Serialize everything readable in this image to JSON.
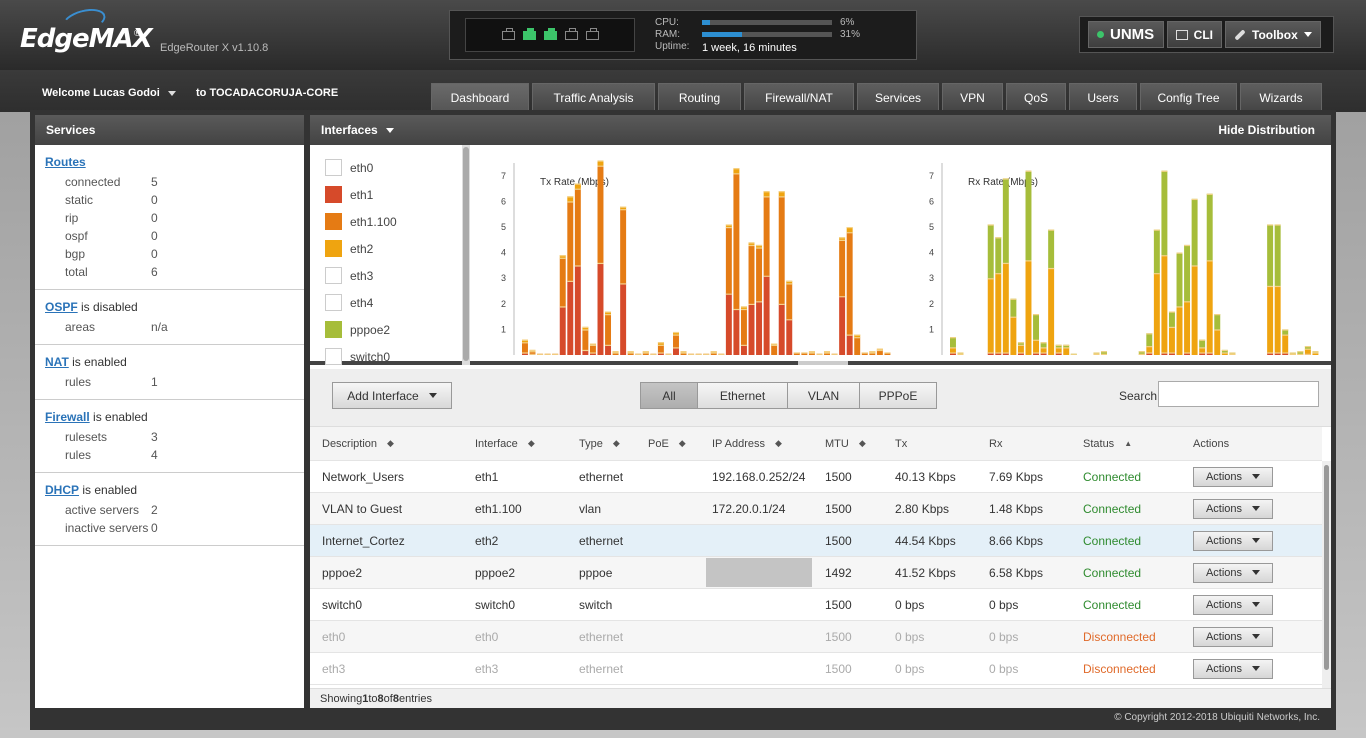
{
  "header": {
    "logo": "EdgeMAX",
    "logo_reg": "®",
    "version": "EdgeRouter X v1.10.8",
    "cpu_label": "CPU:",
    "cpu_value": "6%",
    "cpu_fraction": 0.06,
    "ram_label": "RAM:",
    "ram_value": "31%",
    "ram_fraction": 0.31,
    "uptime_label": "Uptime:",
    "uptime_value": "1 week, 16 minutes",
    "ports_active": [
      false,
      true,
      true,
      false,
      false
    ]
  },
  "toolbar": {
    "unms": "UNMS",
    "cli": "CLI",
    "toolbox": "Toolbox"
  },
  "user": {
    "welcome": "Welcome Lucas Godoi",
    "router": "to TOCADACORUJA-CORE"
  },
  "tabs": [
    "Dashboard",
    "Traffic Analysis",
    "Routing",
    "Firewall/NAT",
    "Services",
    "VPN",
    "QoS",
    "Users",
    "Config Tree",
    "Wizards"
  ],
  "services": {
    "title": "Services",
    "routes": {
      "link": "Routes",
      "rows": [
        {
          "k": "connected",
          "v": "5"
        },
        {
          "k": "static",
          "v": "0"
        },
        {
          "k": "rip",
          "v": "0"
        },
        {
          "k": "ospf",
          "v": "0"
        },
        {
          "k": "bgp",
          "v": "0"
        },
        {
          "k": "total",
          "v": "6"
        }
      ]
    },
    "ospf": {
      "link": "OSPF",
      "status": " is disabled",
      "rows": [
        {
          "k": "areas",
          "v": "n/a"
        }
      ]
    },
    "nat": {
      "link": "NAT",
      "status": " is enabled",
      "rows": [
        {
          "k": "rules",
          "v": "1"
        }
      ]
    },
    "firewall": {
      "link": "Firewall",
      "status": " is enabled",
      "rows": [
        {
          "k": "rulesets",
          "v": "3"
        },
        {
          "k": "rules",
          "v": "4"
        }
      ]
    },
    "dhcp": {
      "link": "DHCP",
      "status": " is enabled",
      "rows": [
        {
          "k": "active servers",
          "v": "2"
        },
        {
          "k": "inactive servers",
          "v": "0"
        }
      ]
    }
  },
  "interfaces": {
    "title": "Interfaces",
    "hide_distribution": "Hide Distribution",
    "legend": [
      {
        "name": "eth0",
        "color": "#ffffff"
      },
      {
        "name": "eth1",
        "color": "#d64a2a"
      },
      {
        "name": "eth1.100",
        "color": "#e57b14"
      },
      {
        "name": "eth2",
        "color": "#efa410"
      },
      {
        "name": "eth3",
        "color": "#ffffff"
      },
      {
        "name": "eth4",
        "color": "#ffffff"
      },
      {
        "name": "pppoe2",
        "color": "#a6bd3a"
      },
      {
        "name": "switch0",
        "color": "#ffffff"
      }
    ],
    "add_interface": "Add Interface",
    "filters": [
      "All",
      "Ethernet",
      "VLAN",
      "PPPoE"
    ],
    "search_label": "Search",
    "columns": [
      "Description",
      "Interface",
      "Type",
      "PoE",
      "IP Address",
      "MTU",
      "Tx",
      "Rx",
      "Status",
      "Actions"
    ],
    "rows": [
      {
        "desc": "Network_Users",
        "iface": "eth1",
        "type": "ethernet",
        "poe": "",
        "ip": "192.168.0.252/24",
        "mtu": "1500",
        "tx": "40.13 Kbps",
        "rx": "7.69 Kbps",
        "status": "Connected",
        "action": "Actions"
      },
      {
        "desc": "VLAN to Guest",
        "iface": "eth1.100",
        "type": "vlan",
        "poe": "",
        "ip": "172.20.0.1/24",
        "mtu": "1500",
        "tx": "2.80 Kbps",
        "rx": "1.48 Kbps",
        "status": "Connected",
        "action": "Actions"
      },
      {
        "desc": "Internet_Cortez",
        "iface": "eth2",
        "type": "ethernet",
        "poe": "",
        "ip": "",
        "mtu": "1500",
        "tx": "44.54 Kbps",
        "rx": "8.66 Kbps",
        "status": "Connected",
        "action": "Actions"
      },
      {
        "desc": "pppoe2",
        "iface": "pppoe2",
        "type": "pppoe",
        "poe": "",
        "ip": "",
        "mtu": "1492",
        "tx": "41.52 Kbps",
        "rx": "6.58 Kbps",
        "status": "Connected",
        "action": "Actions"
      },
      {
        "desc": "switch0",
        "iface": "switch0",
        "type": "switch",
        "poe": "",
        "ip": "",
        "mtu": "1500",
        "tx": "0 bps",
        "rx": "0 bps",
        "status": "Connected",
        "action": "Actions"
      },
      {
        "desc": "eth0",
        "iface": "eth0",
        "type": "ethernet",
        "poe": "",
        "ip": "",
        "mtu": "1500",
        "tx": "0 bps",
        "rx": "0 bps",
        "status": "Disconnected",
        "action": "Actions"
      },
      {
        "desc": "eth3",
        "iface": "eth3",
        "type": "ethernet",
        "poe": "",
        "ip": "",
        "mtu": "1500",
        "tx": "0 bps",
        "rx": "0 bps",
        "status": "Disconnected",
        "action": "Actions"
      }
    ],
    "showing_prefix": "Showing ",
    "showing_from": "1",
    "showing_mid1": " to ",
    "showing_to": "8",
    "showing_mid2": " of ",
    "showing_total": "8",
    "showing_suffix": " entries"
  },
  "footer": {
    "copyright": "© Copyright 2012-2018 Ubiquiti Networks, Inc."
  },
  "chart_data": [
    {
      "type": "bar",
      "title": "Tx Rate (Mbps)",
      "ylim": [
        0,
        7.5
      ],
      "yticks": [
        1,
        2,
        3,
        4,
        5,
        6,
        7
      ],
      "series": [
        {
          "name": "eth1",
          "color": "#d64a2a",
          "values": [
            0.1,
            0.05,
            0,
            0,
            0,
            1.9,
            2.9,
            3.5,
            0.2,
            0.1,
            3.6,
            0.4,
            0,
            2.8,
            0,
            0,
            0,
            0,
            0.1,
            0,
            0.3,
            0,
            0,
            0,
            0,
            0,
            0,
            2.4,
            1.8,
            0.4,
            2.0,
            2.1,
            3.1,
            0,
            2.0,
            1.4,
            0,
            0,
            0,
            0,
            0,
            0,
            2.3,
            0.8,
            0,
            0,
            0,
            0,
            0
          ]
        },
        {
          "name": "eth1.100",
          "color": "#e57b14",
          "values": [
            0.4,
            0.1,
            0.05,
            0.05,
            0.05,
            1.9,
            3.1,
            3.0,
            0.8,
            0.3,
            3.8,
            1.2,
            0.1,
            2.9,
            0.1,
            0.05,
            0.1,
            0.05,
            0.3,
            0.05,
            0.5,
            0.1,
            0.05,
            0.05,
            0.05,
            0.1,
            0.05,
            2.6,
            5.3,
            1.4,
            2.3,
            2.1,
            3.1,
            0.4,
            4.2,
            1.4,
            0.1,
            0.1,
            0.1,
            0.05,
            0.1,
            0.05,
            2.2,
            4.0,
            0.7,
            0.1,
            0.1,
            0.2,
            0.1
          ]
        },
        {
          "name": "pppoe2",
          "color": "#efa410",
          "values": [
            0.1,
            0.05,
            0,
            0,
            0,
            0.1,
            0.2,
            0.2,
            0.1,
            0.05,
            0.2,
            0.1,
            0.05,
            0.1,
            0.05,
            0,
            0.05,
            0,
            0.1,
            0,
            0.1,
            0.05,
            0,
            0,
            0,
            0.05,
            0,
            0.1,
            0.2,
            0.1,
            0.1,
            0.1,
            0.2,
            0.05,
            0.2,
            0.1,
            0,
            0,
            0.05,
            0,
            0.05,
            0,
            0.1,
            0.2,
            0.1,
            0,
            0.05,
            0.05,
            0
          ]
        }
      ]
    },
    {
      "type": "bar",
      "title": "Rx Rate (Mbps)",
      "ylim": [
        0,
        7.5
      ],
      "yticks": [
        1,
        2,
        3,
        4,
        5,
        6,
        7
      ],
      "series": [
        {
          "name": "eth1",
          "color": "#d64a2a",
          "values": [
            0.1,
            0,
            0,
            0,
            0,
            0.1,
            0.1,
            0.1,
            0,
            0.1,
            0,
            0.1,
            0.1,
            0,
            0.1,
            0,
            0,
            0,
            0,
            0,
            0,
            0,
            0,
            0,
            0,
            0,
            0.1,
            0,
            0.1,
            0.1,
            0,
            0.1,
            0,
            0.1,
            0.1,
            0,
            0,
            0,
            0,
            0,
            0,
            0,
            0.1,
            0.1,
            0.1,
            0,
            0,
            0.05,
            0
          ]
        },
        {
          "name": "eth2",
          "color": "#efa410",
          "values": [
            0.2,
            0.05,
            0,
            0,
            0,
            2.9,
            3.1,
            3.5,
            1.5,
            0.3,
            3.7,
            0.5,
            0.2,
            3.4,
            0.2,
            0.3,
            0,
            0,
            0,
            0.05,
            0.05,
            0,
            0,
            0,
            0,
            0.05,
            0.25,
            3.2,
            3.8,
            1.0,
            1.9,
            2.0,
            3.5,
            0.2,
            3.6,
            1.0,
            0.1,
            0.05,
            0,
            0,
            0,
            0,
            2.6,
            2.6,
            0.7,
            0.05,
            0.05,
            0.2,
            0.1
          ]
        },
        {
          "name": "pppoe2",
          "color": "#a6bd3a",
          "values": [
            0.4,
            0.05,
            0,
            0,
            0,
            2.1,
            1.4,
            3.3,
            0.7,
            0.1,
            3.5,
            1.0,
            0.2,
            1.5,
            0.1,
            0.1,
            0.05,
            0,
            0,
            0.05,
            0.1,
            0,
            0,
            0,
            0,
            0.1,
            0.5,
            1.7,
            3.3,
            0.6,
            2.1,
            2.2,
            2.6,
            0.3,
            2.6,
            0.6,
            0.1,
            0.05,
            0,
            0,
            0,
            0,
            2.4,
            2.4,
            0.2,
            0.05,
            0.1,
            0.1,
            0.05
          ]
        }
      ]
    }
  ]
}
